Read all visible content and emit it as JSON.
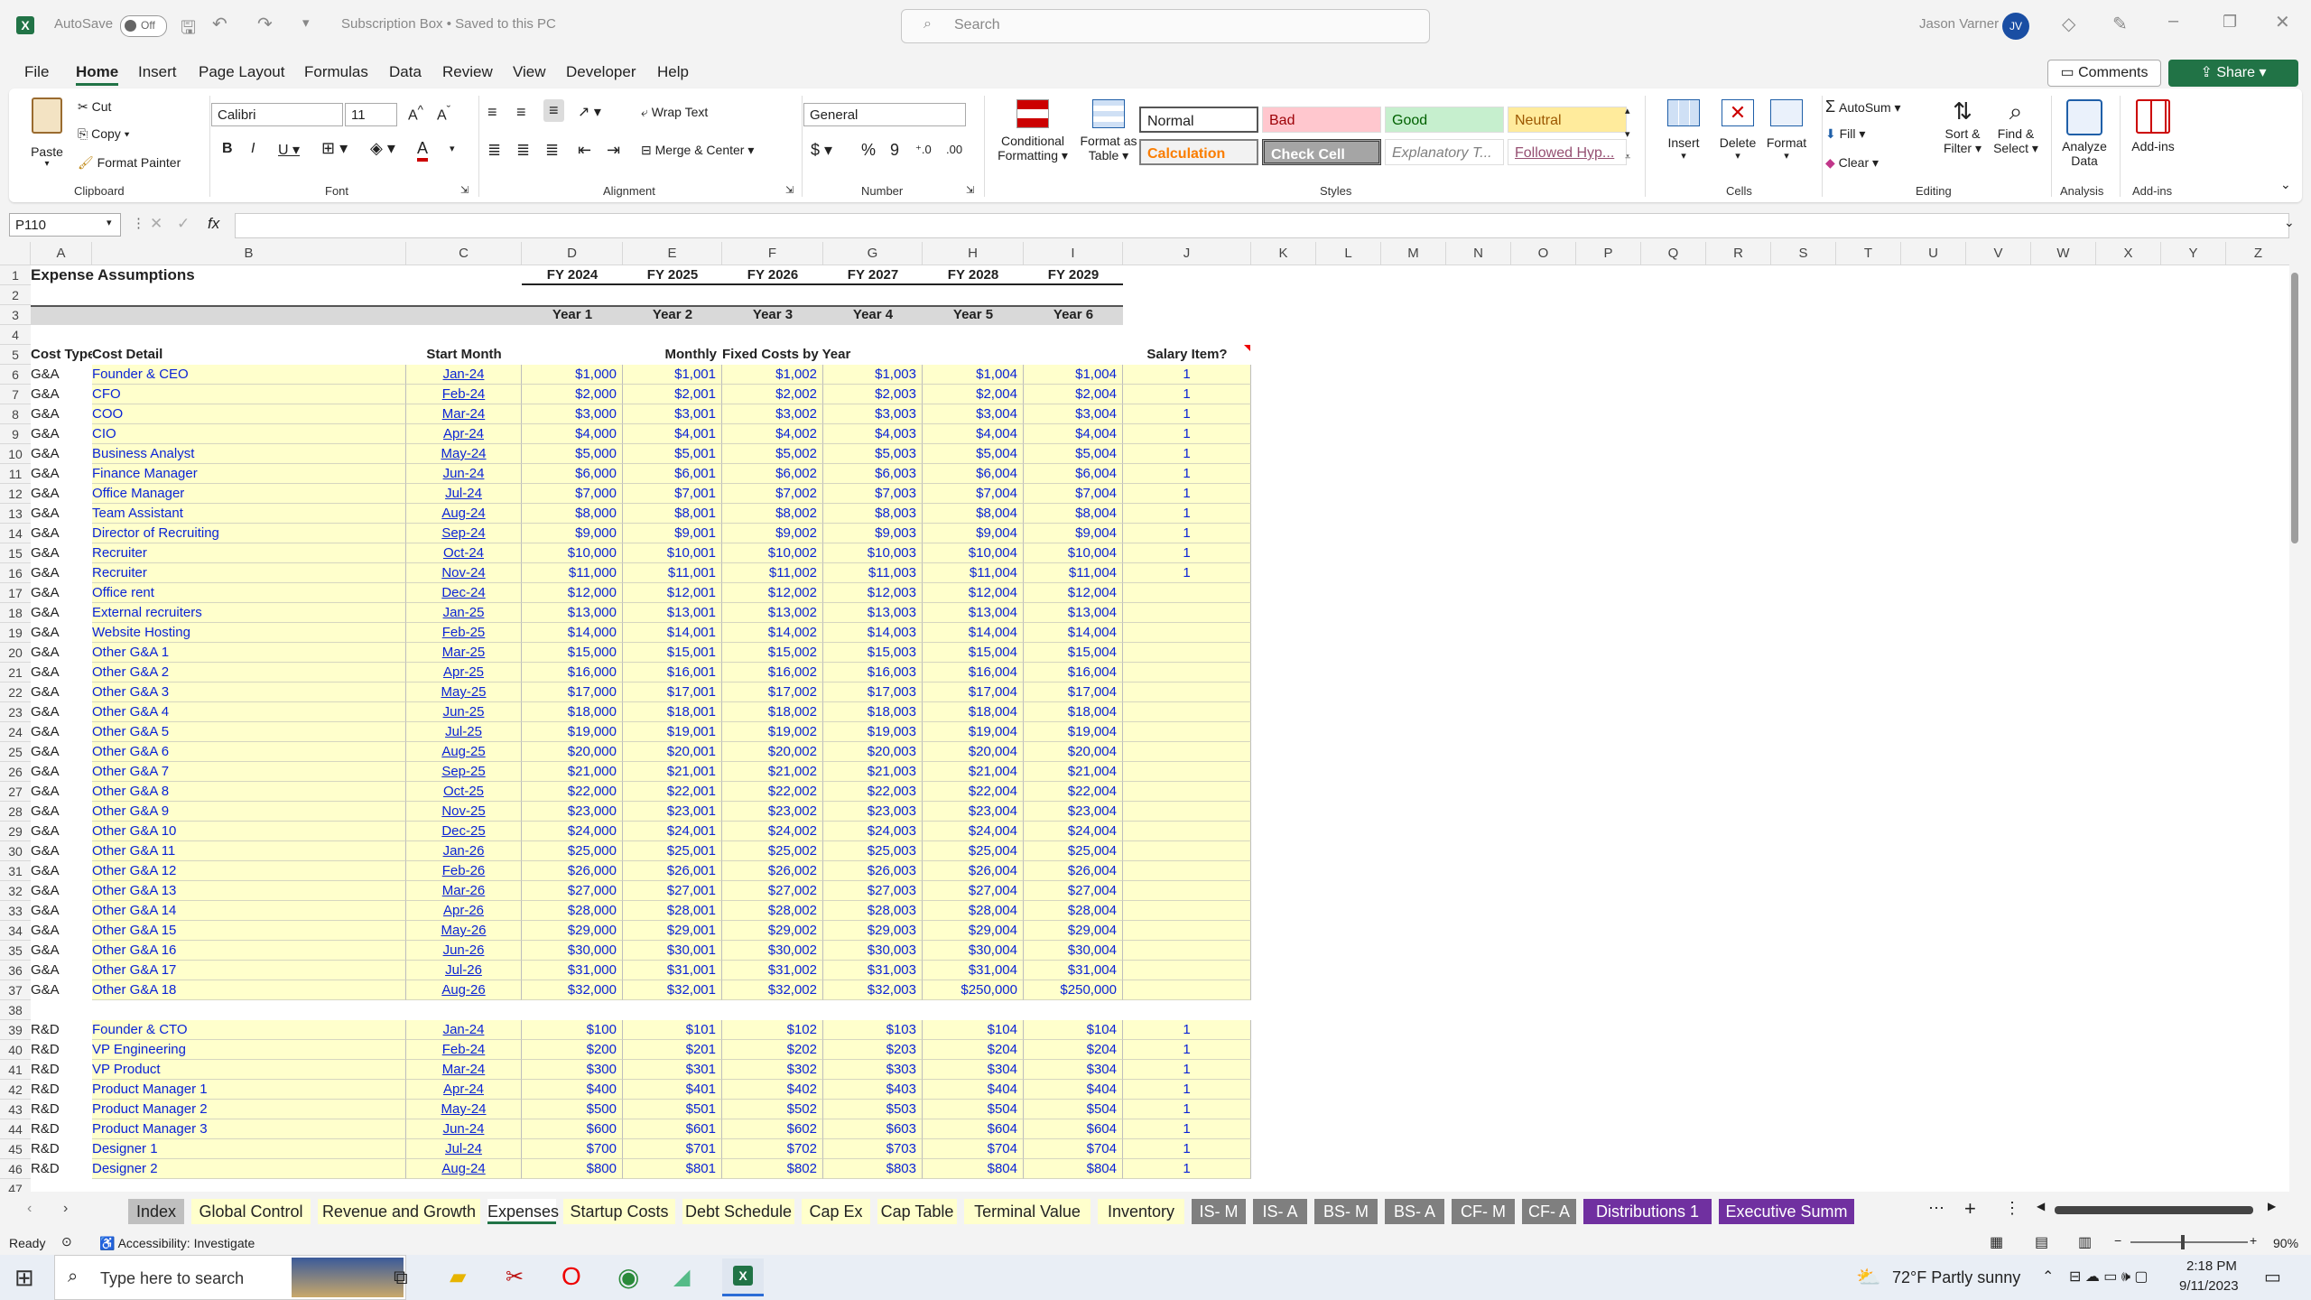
{
  "titlebar": {
    "autosave": "AutoSave",
    "autosave_state": "Off",
    "doc_title": "Subscription Box • Saved to this PC",
    "search_placeholder": "Search",
    "user": "Jason Varner",
    "user_initials": "JV"
  },
  "menu": [
    "File",
    "Home",
    "Insert",
    "Page Layout",
    "Formulas",
    "Data",
    "Review",
    "View",
    "Developer",
    "Help"
  ],
  "menu_right": {
    "comments": "Comments",
    "share": "Share"
  },
  "ribbon": {
    "clipboard": {
      "paste": "Paste",
      "cut": "Cut",
      "copy": "Copy",
      "format_painter": "Format Painter",
      "label": "Clipboard"
    },
    "font": {
      "name": "Calibri",
      "size": "11",
      "label": "Font"
    },
    "alignment": {
      "wrap": "Wrap Text",
      "merge": "Merge & Center",
      "label": "Alignment"
    },
    "number": {
      "format": "General",
      "label": "Number"
    },
    "styles": {
      "cond": "Conditional",
      "cond2": "Formatting",
      "fmt_table": "Format as",
      "fmt_table2": "Table",
      "label": "Styles",
      "cells": [
        {
          "t": "Normal"
        },
        {
          "t": "Bad"
        },
        {
          "t": "Good"
        },
        {
          "t": "Neutral"
        },
        {
          "t": "Calculation"
        },
        {
          "t": "Check Cell"
        },
        {
          "t": "Explanatory T..."
        },
        {
          "t": "Followed Hyp..."
        }
      ]
    },
    "cells": {
      "insert": "Insert",
      "delete": "Delete",
      "format": "Format",
      "label": "Cells"
    },
    "editing": {
      "autosum": "AutoSum",
      "fill": "Fill",
      "clear": "Clear",
      "sort": "Sort &",
      "sort2": "Filter",
      "find": "Find &",
      "find2": "Select",
      "label": "Editing"
    },
    "analysis": {
      "analyze": "Analyze",
      "analyze2": "Data",
      "label": "Analysis"
    },
    "addins": {
      "addins": "Add-ins",
      "label": "Add-ins"
    }
  },
  "formula_bar": {
    "name_box": "P110",
    "fx": "fx",
    "value": ""
  },
  "columns": [
    "A",
    "B",
    "C",
    "D",
    "E",
    "F",
    "G",
    "H",
    "I",
    "J",
    "K",
    "L",
    "M",
    "N",
    "O",
    "P",
    "Q",
    "R",
    "S",
    "T",
    "U",
    "V",
    "W",
    "X",
    "Y",
    "Z"
  ],
  "sheet": {
    "title": "Expense Assumptions",
    "fy": [
      "FY 2024",
      "FY 2025",
      "FY 2026",
      "FY 2027",
      "FY 2028",
      "FY 2029"
    ],
    "years": [
      "Year 1",
      "Year 2",
      "Year 3",
      "Year 4",
      "Year 5",
      "Year 6"
    ],
    "hdr": {
      "type": "Cost Type",
      "detail": "Cost Detail",
      "start": "Start Month",
      "monthly": "Monthly",
      "fixed": "Fixed Costs by Year",
      "salary": "Salary Item?"
    },
    "rows": [
      [
        "6",
        "G&A",
        "Founder & CEO",
        "Jan-24",
        "$1,000",
        "$1,001",
        "$1,002",
        "$1,003",
        "$1,004",
        "$1,004",
        "1"
      ],
      [
        "7",
        "G&A",
        "CFO",
        "Feb-24",
        "$2,000",
        "$2,001",
        "$2,002",
        "$2,003",
        "$2,004",
        "$2,004",
        "1"
      ],
      [
        "8",
        "G&A",
        "COO",
        "Mar-24",
        "$3,000",
        "$3,001",
        "$3,002",
        "$3,003",
        "$3,004",
        "$3,004",
        "1"
      ],
      [
        "9",
        "G&A",
        "CIO",
        "Apr-24",
        "$4,000",
        "$4,001",
        "$4,002",
        "$4,003",
        "$4,004",
        "$4,004",
        "1"
      ],
      [
        "10",
        "G&A",
        "Business Analyst",
        "May-24",
        "$5,000",
        "$5,001",
        "$5,002",
        "$5,003",
        "$5,004",
        "$5,004",
        "1"
      ],
      [
        "11",
        "G&A",
        "Finance Manager",
        "Jun-24",
        "$6,000",
        "$6,001",
        "$6,002",
        "$6,003",
        "$6,004",
        "$6,004",
        "1"
      ],
      [
        "12",
        "G&A",
        "Office Manager",
        "Jul-24",
        "$7,000",
        "$7,001",
        "$7,002",
        "$7,003",
        "$7,004",
        "$7,004",
        "1"
      ],
      [
        "13",
        "G&A",
        "Team Assistant",
        "Aug-24",
        "$8,000",
        "$8,001",
        "$8,002",
        "$8,003",
        "$8,004",
        "$8,004",
        "1"
      ],
      [
        "14",
        "G&A",
        "Director of Recruiting",
        "Sep-24",
        "$9,000",
        "$9,001",
        "$9,002",
        "$9,003",
        "$9,004",
        "$9,004",
        "1"
      ],
      [
        "15",
        "G&A",
        "Recruiter",
        "Oct-24",
        "$10,000",
        "$10,001",
        "$10,002",
        "$10,003",
        "$10,004",
        "$10,004",
        "1"
      ],
      [
        "16",
        "G&A",
        "Recruiter",
        "Nov-24",
        "$11,000",
        "$11,001",
        "$11,002",
        "$11,003",
        "$11,004",
        "$11,004",
        "1"
      ],
      [
        "17",
        "G&A",
        "Office rent",
        "Dec-24",
        "$12,000",
        "$12,001",
        "$12,002",
        "$12,003",
        "$12,004",
        "$12,004",
        ""
      ],
      [
        "18",
        "G&A",
        "External recruiters",
        "Jan-25",
        "$13,000",
        "$13,001",
        "$13,002",
        "$13,003",
        "$13,004",
        "$13,004",
        ""
      ],
      [
        "19",
        "G&A",
        "Website Hosting",
        "Feb-25",
        "$14,000",
        "$14,001",
        "$14,002",
        "$14,003",
        "$14,004",
        "$14,004",
        ""
      ],
      [
        "20",
        "G&A",
        "Other G&A 1",
        "Mar-25",
        "$15,000",
        "$15,001",
        "$15,002",
        "$15,003",
        "$15,004",
        "$15,004",
        ""
      ],
      [
        "21",
        "G&A",
        "Other G&A 2",
        "Apr-25",
        "$16,000",
        "$16,001",
        "$16,002",
        "$16,003",
        "$16,004",
        "$16,004",
        ""
      ],
      [
        "22",
        "G&A",
        "Other G&A 3",
        "May-25",
        "$17,000",
        "$17,001",
        "$17,002",
        "$17,003",
        "$17,004",
        "$17,004",
        ""
      ],
      [
        "23",
        "G&A",
        "Other G&A 4",
        "Jun-25",
        "$18,000",
        "$18,001",
        "$18,002",
        "$18,003",
        "$18,004",
        "$18,004",
        ""
      ],
      [
        "24",
        "G&A",
        "Other G&A 5",
        "Jul-25",
        "$19,000",
        "$19,001",
        "$19,002",
        "$19,003",
        "$19,004",
        "$19,004",
        ""
      ],
      [
        "25",
        "G&A",
        "Other G&A 6",
        "Aug-25",
        "$20,000",
        "$20,001",
        "$20,002",
        "$20,003",
        "$20,004",
        "$20,004",
        ""
      ],
      [
        "26",
        "G&A",
        "Other G&A 7",
        "Sep-25",
        "$21,000",
        "$21,001",
        "$21,002",
        "$21,003",
        "$21,004",
        "$21,004",
        ""
      ],
      [
        "27",
        "G&A",
        "Other G&A 8",
        "Oct-25",
        "$22,000",
        "$22,001",
        "$22,002",
        "$22,003",
        "$22,004",
        "$22,004",
        ""
      ],
      [
        "28",
        "G&A",
        "Other G&A 9",
        "Nov-25",
        "$23,000",
        "$23,001",
        "$23,002",
        "$23,003",
        "$23,004",
        "$23,004",
        ""
      ],
      [
        "29",
        "G&A",
        "Other G&A 10",
        "Dec-25",
        "$24,000",
        "$24,001",
        "$24,002",
        "$24,003",
        "$24,004",
        "$24,004",
        ""
      ],
      [
        "30",
        "G&A",
        "Other G&A 11",
        "Jan-26",
        "$25,000",
        "$25,001",
        "$25,002",
        "$25,003",
        "$25,004",
        "$25,004",
        ""
      ],
      [
        "31",
        "G&A",
        "Other G&A 12",
        "Feb-26",
        "$26,000",
        "$26,001",
        "$26,002",
        "$26,003",
        "$26,004",
        "$26,004",
        ""
      ],
      [
        "32",
        "G&A",
        "Other G&A 13",
        "Mar-26",
        "$27,000",
        "$27,001",
        "$27,002",
        "$27,003",
        "$27,004",
        "$27,004",
        ""
      ],
      [
        "33",
        "G&A",
        "Other G&A 14",
        "Apr-26",
        "$28,000",
        "$28,001",
        "$28,002",
        "$28,003",
        "$28,004",
        "$28,004",
        ""
      ],
      [
        "34",
        "G&A",
        "Other G&A 15",
        "May-26",
        "$29,000",
        "$29,001",
        "$29,002",
        "$29,003",
        "$29,004",
        "$29,004",
        ""
      ],
      [
        "35",
        "G&A",
        "Other G&A 16",
        "Jun-26",
        "$30,000",
        "$30,001",
        "$30,002",
        "$30,003",
        "$30,004",
        "$30,004",
        ""
      ],
      [
        "36",
        "G&A",
        "Other G&A 17",
        "Jul-26",
        "$31,000",
        "$31,001",
        "$31,002",
        "$31,003",
        "$31,004",
        "$31,004",
        ""
      ],
      [
        "37",
        "G&A",
        "Other G&A 18",
        "Aug-26",
        "$32,000",
        "$32,001",
        "$32,002",
        "$32,003",
        "$250,000",
        "$250,000",
        ""
      ],
      [
        "38",
        "",
        "",
        "",
        "",
        "",
        "",
        "",
        "",
        "",
        ""
      ],
      [
        "39",
        "R&D",
        "Founder & CTO",
        "Jan-24",
        "$100",
        "$101",
        "$102",
        "$103",
        "$104",
        "$104",
        "1"
      ],
      [
        "40",
        "R&D",
        "VP Engineering",
        "Feb-24",
        "$200",
        "$201",
        "$202",
        "$203",
        "$204",
        "$204",
        "1"
      ],
      [
        "41",
        "R&D",
        "VP Product",
        "Mar-24",
        "$300",
        "$301",
        "$302",
        "$303",
        "$304",
        "$304",
        "1"
      ],
      [
        "42",
        "R&D",
        "Product Manager 1",
        "Apr-24",
        "$400",
        "$401",
        "$402",
        "$403",
        "$404",
        "$404",
        "1"
      ],
      [
        "43",
        "R&D",
        "Product Manager 2",
        "May-24",
        "$500",
        "$501",
        "$502",
        "$503",
        "$504",
        "$504",
        "1"
      ],
      [
        "44",
        "R&D",
        "Product Manager 3",
        "Jun-24",
        "$600",
        "$601",
        "$602",
        "$603",
        "$604",
        "$604",
        "1"
      ],
      [
        "45",
        "R&D",
        "Designer 1",
        "Jul-24",
        "$700",
        "$701",
        "$702",
        "$703",
        "$704",
        "$704",
        "1"
      ],
      [
        "46",
        "R&D",
        "Designer 2",
        "Aug-24",
        "$800",
        "$801",
        "$802",
        "$803",
        "$804",
        "$804",
        "1"
      ]
    ]
  },
  "tabs": [
    {
      "label": "Index",
      "style": "gray"
    },
    {
      "label": "Global Control",
      "style": "yellow"
    },
    {
      "label": "Revenue and Growth",
      "style": "yellow"
    },
    {
      "label": "Expenses",
      "style": "active"
    },
    {
      "label": "Startup Costs",
      "style": "yellow"
    },
    {
      "label": "Debt Schedule",
      "style": "yellow"
    },
    {
      "label": "Cap Ex",
      "style": "yellow"
    },
    {
      "label": "Cap Table",
      "style": "yellow"
    },
    {
      "label": "Terminal Value",
      "style": "yellow"
    },
    {
      "label": "Inventory",
      "style": "yellow"
    },
    {
      "label": "IS- M",
      "style": "dark"
    },
    {
      "label": "IS- A",
      "style": "dark"
    },
    {
      "label": "BS- M",
      "style": "dark"
    },
    {
      "label": "BS- A",
      "style": "dark"
    },
    {
      "label": "CF- M",
      "style": "dark"
    },
    {
      "label": "CF- A",
      "style": "dark"
    },
    {
      "label": "Distributions 1",
      "style": "purple"
    },
    {
      "label": "Executive Summ",
      "style": "purple"
    }
  ],
  "status": {
    "ready": "Ready",
    "accessibility": "Accessibility: Investigate",
    "zoom": "90%"
  },
  "taskbar": {
    "search_placeholder": "Type here to search",
    "weather": "72°F  Partly sunny",
    "time": "2:18 PM",
    "date": "9/11/2023"
  },
  "colors": {
    "excel_green": "#217346",
    "cell_yellow": "#ffffcc",
    "input_blue": "#0b24d6",
    "purple_tab": "#7030a0"
  }
}
